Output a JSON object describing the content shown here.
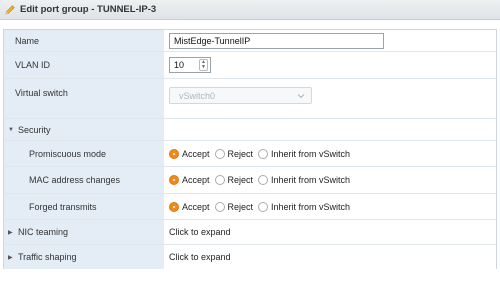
{
  "dialog": {
    "title": "Edit port group - TUNNEL-IP-3"
  },
  "fields": {
    "name": {
      "label": "Name",
      "value": "MistEdge-TunnelIP"
    },
    "vlan": {
      "label": "VLAN ID",
      "value": "10"
    },
    "vswitch": {
      "label": "Virtual switch",
      "value": "vSwitch0"
    }
  },
  "security": {
    "label": "Security",
    "options": [
      "Accept",
      "Reject",
      "Inherit from vSwitch"
    ],
    "rows": [
      {
        "label": "Promiscuous mode",
        "selected": "Accept"
      },
      {
        "label": "MAC address changes",
        "selected": "Accept"
      },
      {
        "label": "Forged transmits",
        "selected": "Accept"
      }
    ]
  },
  "nic_teaming": {
    "label": "NIC teaming",
    "value": "Click to expand"
  },
  "traffic_shaping": {
    "label": "Traffic shaping",
    "value": "Click to expand"
  },
  "colors": {
    "accent": "#f08a1c",
    "label_bg": "#e4edf5"
  }
}
